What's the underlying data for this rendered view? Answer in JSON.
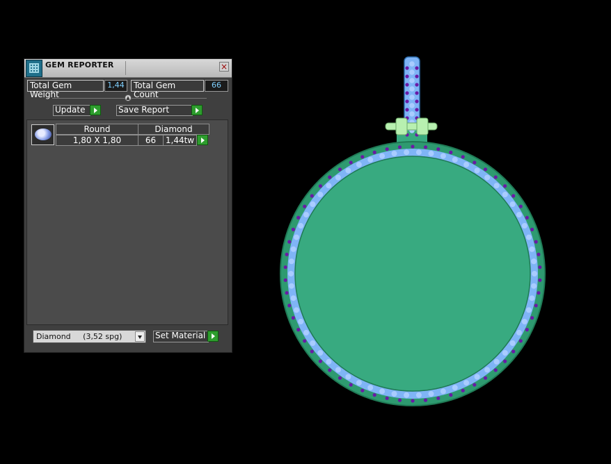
{
  "panel": {
    "title": "GEM REPORTER",
    "close_label": "×",
    "total_weight_label": "Total Gem Weight",
    "total_weight_value": "1,44",
    "total_count_label": "Total Gem Count",
    "total_count_value": "66",
    "update_label": "Update",
    "save_report_label": "Save Report",
    "table": {
      "header_shape": "Round",
      "header_material": "Diamond",
      "size": "1,80 X 1,80",
      "count": "66",
      "weight": "1,44tw"
    },
    "material_select": "Diamond     (3,52 spg)",
    "set_material_label": "Set Material"
  },
  "viewport": {
    "pendant_fill": "#38aa80",
    "stone_color": "#7fb4f6",
    "prong_color": "#6a1aa6",
    "bail_color": "#b8f0b0"
  }
}
